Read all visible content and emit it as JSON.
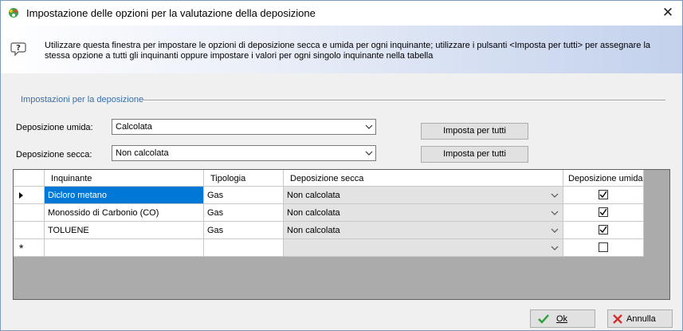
{
  "window": {
    "title": "Impostazione delle opzioni per la valutazione della deposizione"
  },
  "banner": {
    "text": "Utilizzare questa finestra per impostare le opzioni di deposizione secca e umida per ogni inquinante; utilizzare i pulsanti <Imposta per tutti> per assegnare la stessa opzione a tutti gli inquinanti oppure impostare i valori per ogni singolo inquinante nella tabella"
  },
  "group": {
    "title": "Impostazioni per la deposizione"
  },
  "wet": {
    "label": "Deposizione umida:",
    "value": "Calcolata",
    "button": "Imposta per tutti"
  },
  "dry": {
    "label": "Deposizione secca:",
    "value": "Non calcolata",
    "button": "Imposta per tutti"
  },
  "table": {
    "headers": {
      "pollutant": "Inquinante",
      "type": "Tipologia",
      "dry": "Deposizione secca",
      "wet": "Deposizione umida"
    },
    "rows": [
      {
        "pollutant": "Dicloro metano",
        "type": "Gas",
        "dry": "Non calcolata",
        "wet": true,
        "selected": true
      },
      {
        "pollutant": "Monossido di Carbonio (CO)",
        "type": "Gas",
        "dry": "Non calcolata",
        "wet": true,
        "selected": false
      },
      {
        "pollutant": "TOLUENE",
        "type": "Gas",
        "dry": "Non calcolata",
        "wet": true,
        "selected": false
      }
    ],
    "new_row_marker": "*"
  },
  "footer": {
    "ok": "Ok",
    "cancel": "Annulla"
  },
  "colors": {
    "selection": "#0078d7",
    "accent_label": "#3a6ea5",
    "ok_check": "#2e9e3a",
    "cancel_x": "#d03030"
  },
  "icons": {
    "app": "app-icon",
    "info": "info-icon",
    "close": "close-icon",
    "ok": "check-icon",
    "cancel": "x-icon"
  }
}
